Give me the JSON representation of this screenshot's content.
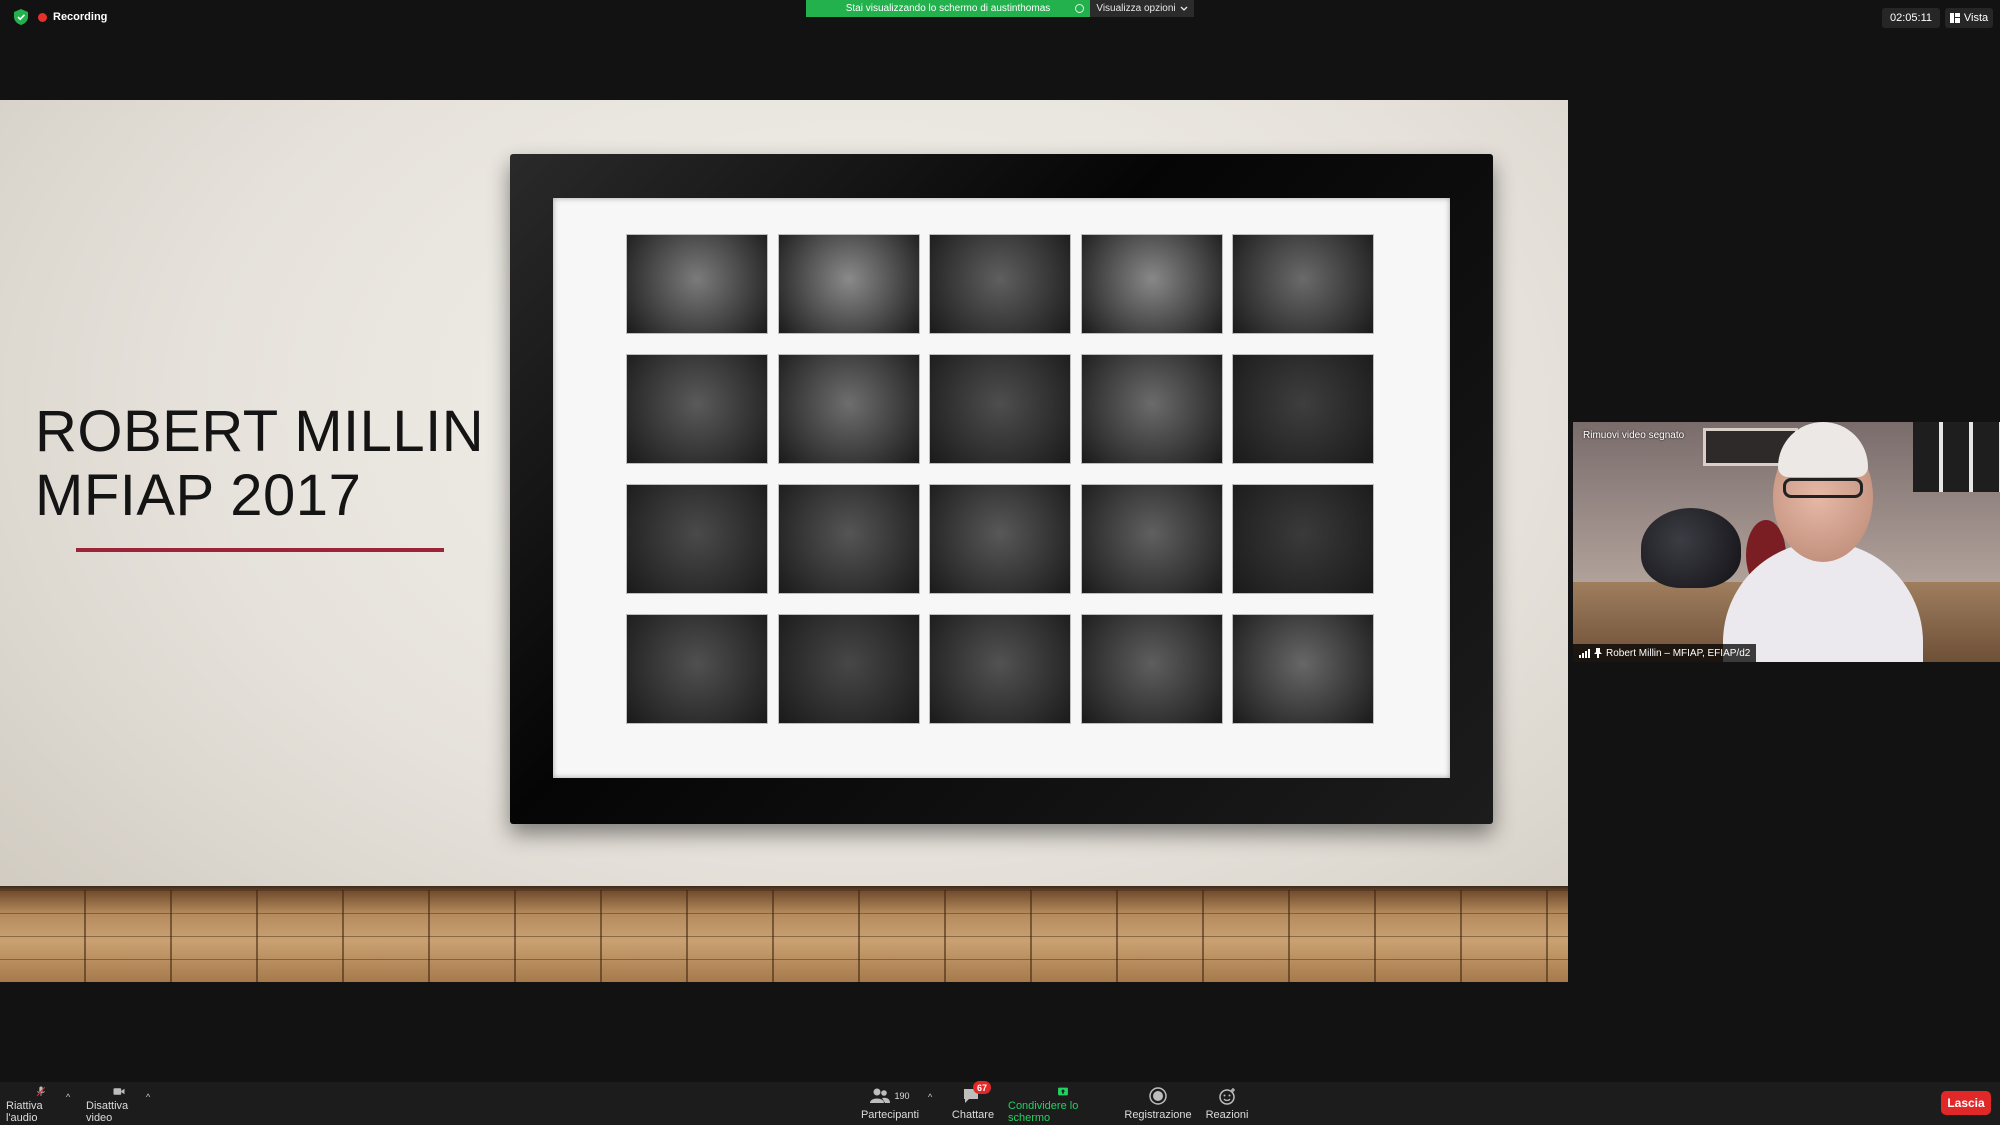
{
  "top_bar": {
    "recording_label": "Recording",
    "share_banner": "Stai visualizzando lo schermo di austinthomas",
    "view_options": "Visualizza opzioni",
    "clock": "02:05:11",
    "view_button": "Vista",
    "recording_color": "#e5312b",
    "banner_color": "#23b14d"
  },
  "slide": {
    "title_line1": "ROBERT MILLIN",
    "title_line2": "MFIAP 2017",
    "accent_color": "#9c2438",
    "photo_tones": [
      [
        "#7b7b7b",
        "#8a8a8a",
        "#5f5f5f",
        "#888888",
        "#6a6a6a"
      ],
      [
        "#5a5a5a",
        "#6e6e6e",
        "#4e4e4e",
        "#6b6b6b",
        "#3e3e3e"
      ],
      [
        "#4a4a4a",
        "#555555",
        "#585858",
        "#606060",
        "#3a3a3a"
      ],
      [
        "#505050",
        "#474747",
        "#525252",
        "#5e5e5e",
        "#676767"
      ]
    ]
  },
  "participant_video": {
    "remove_label": "Rimuovi video segnato",
    "name": "Robert Millin – MFIAP, EFIAP/d2"
  },
  "toolbar": {
    "mute_label": "Riattiva l'audio",
    "video_label": "Disattiva video",
    "participants_label": "Partecipanti",
    "participants_count": "190",
    "chat_label": "Chattare",
    "chat_badge": "67",
    "share_label": "Condividere lo schermo",
    "record_label": "Registrazione",
    "reactions_label": "Reazioni",
    "leave_label": "Lascia",
    "share_color": "#23d160",
    "leave_color": "#e02828"
  }
}
